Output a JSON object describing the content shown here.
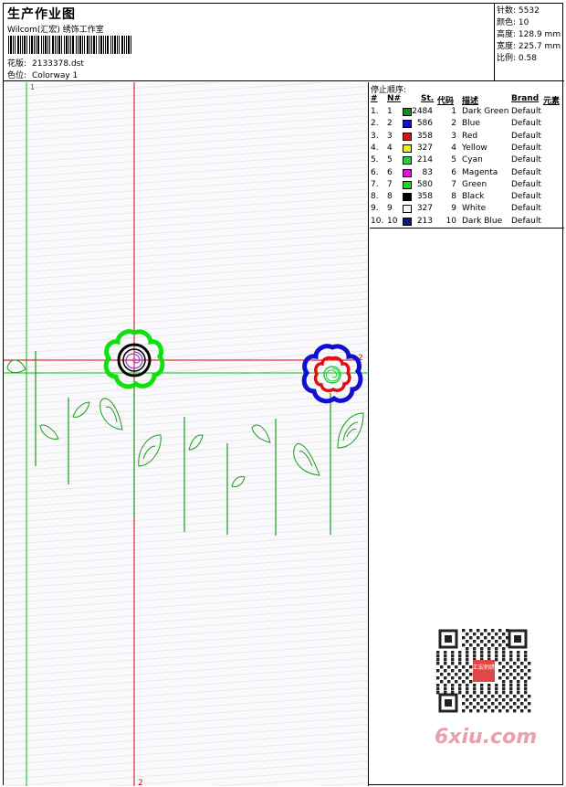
{
  "header": {
    "title": "生产作业图",
    "company": "Wilcom(汇宏) 绣饰工作室",
    "design_label": "花版:",
    "design_value": "2133378.dst",
    "colorway_label": "色位:",
    "colorway_value": "Colorway 1"
  },
  "stats": [
    {
      "label": "针数:",
      "value": "5532"
    },
    {
      "label": "颜色:",
      "value": "10"
    },
    {
      "label": "高度:",
      "value": "128.9 mm"
    },
    {
      "label": "宽度:",
      "value": "225.7 mm"
    },
    {
      "label": "比例:",
      "value": "0.58"
    }
  ],
  "stop_sequence": {
    "title": "停止顺序:",
    "columns": [
      "#",
      "N#",
      "St.",
      "代码",
      "描述",
      "Brand",
      "元素"
    ],
    "rows": [
      {
        "num": "1.",
        "n": "1",
        "stitches": "2484",
        "code": "1",
        "desc": "Dark Green",
        "brand": "Default",
        "color": "#1a8a1a"
      },
      {
        "num": "2.",
        "n": "2",
        "stitches": "586",
        "code": "2",
        "desc": "Blue",
        "brand": "Default",
        "color": "#1010d0"
      },
      {
        "num": "3.",
        "n": "3",
        "stitches": "358",
        "code": "3",
        "desc": "Red",
        "brand": "Default",
        "color": "#e01010"
      },
      {
        "num": "4.",
        "n": "4",
        "stitches": "327",
        "code": "4",
        "desc": "Yellow",
        "brand": "Default",
        "color": "#f0f000"
      },
      {
        "num": "5.",
        "n": "5",
        "stitches": "214",
        "code": "5",
        "desc": "Cyan",
        "brand": "Default",
        "color": "#20d040"
      },
      {
        "num": "6.",
        "n": "6",
        "stitches": "83",
        "code": "6",
        "desc": "Magenta",
        "brand": "Default",
        "color": "#e010e0"
      },
      {
        "num": "7.",
        "n": "7",
        "stitches": "580",
        "code": "7",
        "desc": "Green",
        "brand": "Default",
        "color": "#10e010"
      },
      {
        "num": "8.",
        "n": "8",
        "stitches": "358",
        "code": "8",
        "desc": "Black",
        "brand": "Default",
        "color": "#000000"
      },
      {
        "num": "9.",
        "n": "9",
        "stitches": "327",
        "code": "9",
        "desc": "White",
        "brand": "Default",
        "color": "#f4f4f4"
      },
      {
        "num": "10.",
        "n": "10",
        "stitches": "213",
        "code": "10",
        "desc": "Dark Blue",
        "brand": "Default",
        "color": "#101090"
      }
    ]
  },
  "guides": {
    "green_marker": "1",
    "red_marker_right": "2",
    "red_marker_bottom": "2",
    "green_color": "#00c800",
    "red_color": "#e00000"
  },
  "watermark": {
    "qr_badge": "汇宏刺绣",
    "site": "6xiu.com"
  }
}
